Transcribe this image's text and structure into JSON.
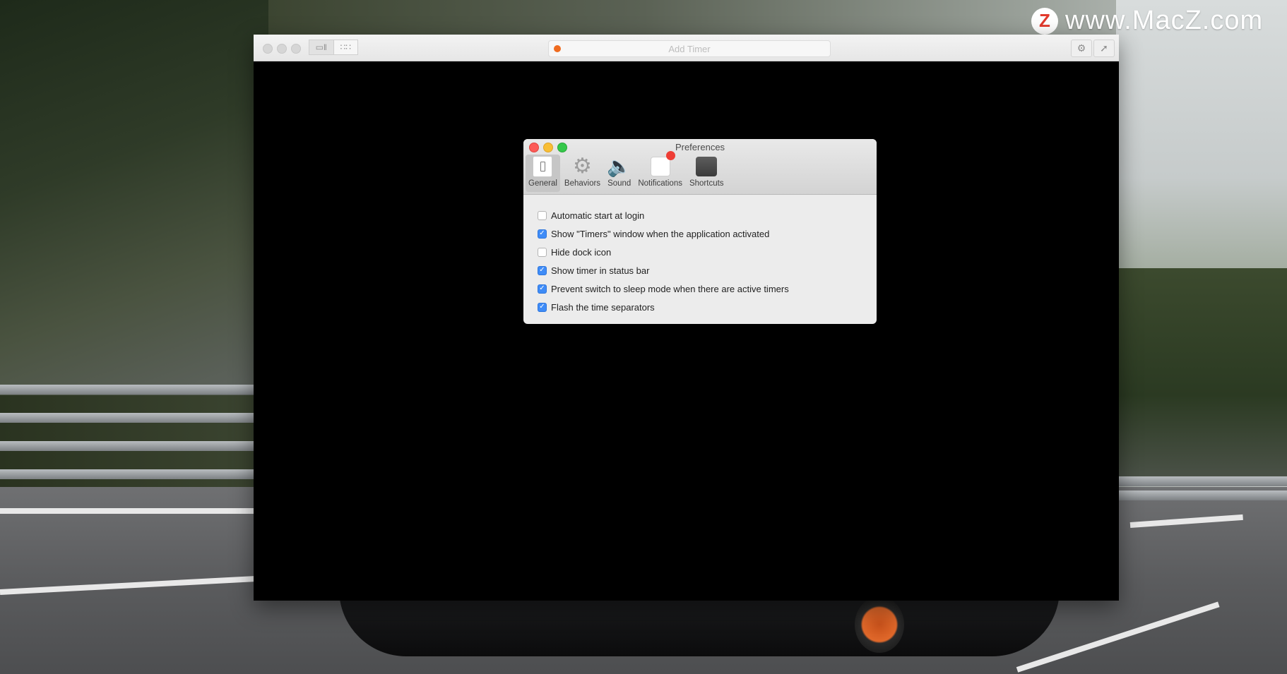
{
  "watermark": {
    "badge": "Z",
    "text": "www.MacZ.com"
  },
  "app": {
    "add_timer_placeholder": "Add Timer",
    "view_buttons": [
      "list-view",
      "grid-view"
    ],
    "icons": {
      "settings": "gear-icon",
      "pin": "pin-icon"
    }
  },
  "preferences": {
    "title": "Preferences",
    "tabs": [
      {
        "label": "General",
        "icon": "general-icon",
        "active": true
      },
      {
        "label": "Behaviors",
        "icon": "gear-icon",
        "active": false
      },
      {
        "label": "Sound",
        "icon": "speaker-icon",
        "active": false
      },
      {
        "label": "Notifications",
        "icon": "notification-icon",
        "active": false
      },
      {
        "label": "Shortcuts",
        "icon": "option-key-icon",
        "active": false
      }
    ],
    "options": [
      {
        "label": "Automatic start at login",
        "checked": false
      },
      {
        "label": "Show \"Timers\" window when the application activated",
        "checked": true
      },
      {
        "label": "Hide dock icon",
        "checked": false
      },
      {
        "label": "Show timer in status bar",
        "checked": true
      },
      {
        "label": "Prevent switch to sleep mode when there are active timers",
        "checked": true
      },
      {
        "label": "Flash the time separators",
        "checked": true
      }
    ],
    "colors": {
      "close": "#fc5b57",
      "minimize": "#f8be35",
      "zoom": "#35c84a",
      "checkbox": "#3f8cf7"
    }
  }
}
